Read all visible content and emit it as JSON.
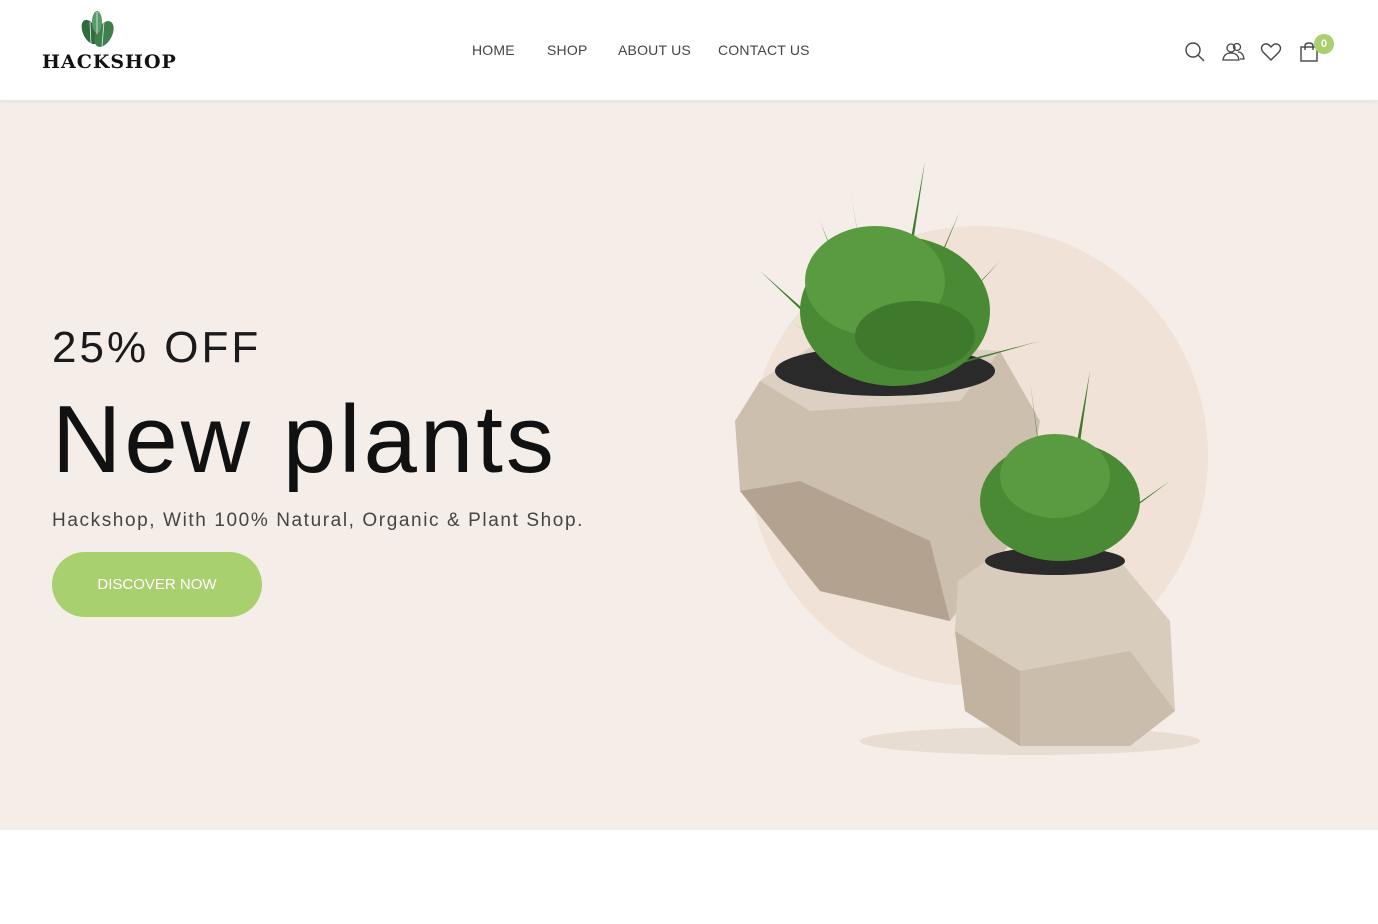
{
  "brand": {
    "logo_text": "HACKSHOP"
  },
  "nav": {
    "items": [
      {
        "label": "HOME"
      },
      {
        "label": "SHOP"
      },
      {
        "label": "ABOUT US"
      },
      {
        "label": "CONTACT US"
      }
    ]
  },
  "header_icons": {
    "search": "search-icon",
    "account": "users-icon",
    "wishlist": "heart-icon",
    "cart": "shopping-bag-icon"
  },
  "cart": {
    "count": "0"
  },
  "hero": {
    "discount": "25% OFF",
    "headline": "New plants",
    "tagline": "Hackshop, With 100% Natural, Organic & Plant Shop.",
    "cta_label": "DISCOVER NOW"
  },
  "colors": {
    "accent": "#a8d06f",
    "hero_bg": "#f5eee8",
    "circle": "#f0e1d6",
    "text_dark": "#111111"
  }
}
